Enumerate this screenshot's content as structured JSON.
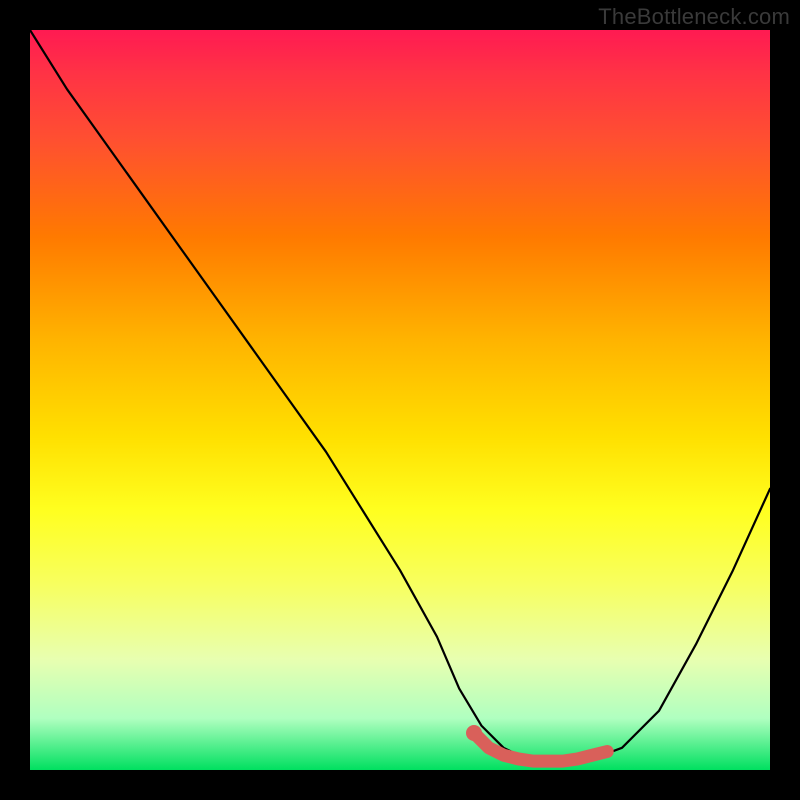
{
  "watermark": "TheBottleneck.com",
  "chart_data": {
    "type": "line",
    "title": "",
    "xlabel": "",
    "ylabel": "",
    "xlim": [
      0,
      100
    ],
    "ylim": [
      0,
      100
    ],
    "series": [
      {
        "name": "bottleneck-curve",
        "color": "#000000",
        "x": [
          0,
          5,
          10,
          15,
          20,
          25,
          30,
          35,
          40,
          45,
          50,
          55,
          58,
          61,
          64,
          67,
          70,
          73,
          76,
          80,
          85,
          90,
          95,
          100
        ],
        "values": [
          100,
          92,
          85,
          78,
          71,
          64,
          57,
          50,
          43,
          35,
          27,
          18,
          11,
          6,
          3,
          1.5,
          1,
          1,
          1.5,
          3,
          8,
          17,
          27,
          38
        ]
      },
      {
        "name": "highlight-segment",
        "color": "#d9605a",
        "x": [
          60,
          62,
          64,
          66,
          68,
          70,
          72,
          74,
          76,
          78
        ],
        "values": [
          5,
          3,
          2,
          1.5,
          1.2,
          1.2,
          1.2,
          1.5,
          2,
          2.5
        ]
      }
    ],
    "highlight_marker": {
      "x": 60,
      "y": 5
    }
  }
}
